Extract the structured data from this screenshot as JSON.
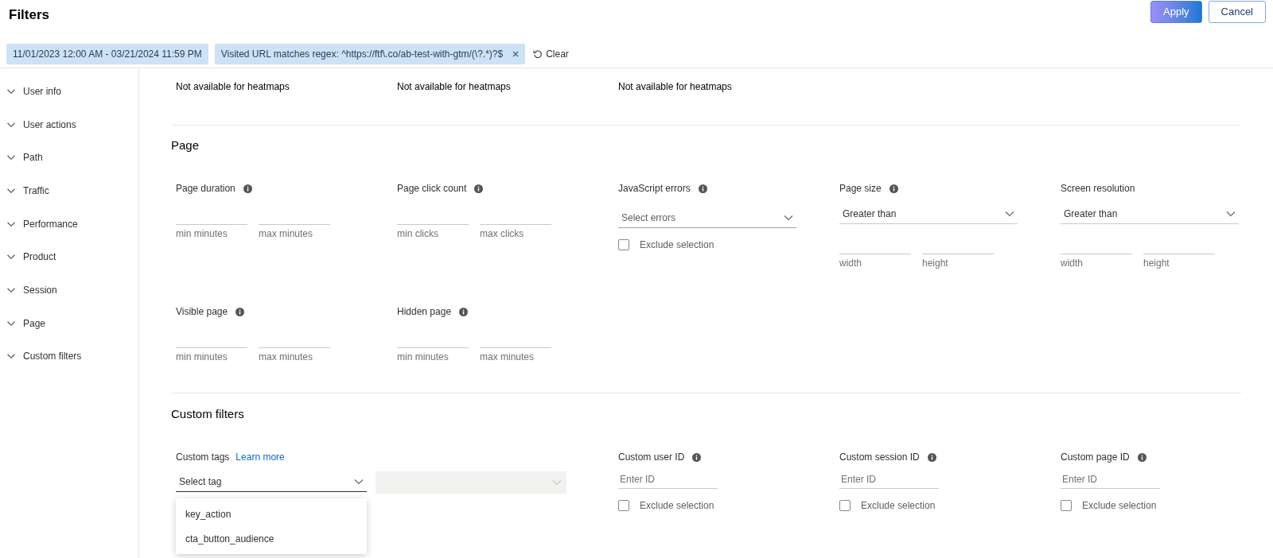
{
  "title": "Filters",
  "buttons": [
    {
      "label": "Apply",
      "kind": "primary"
    },
    {
      "label": "Cancel",
      "kind": "secondary"
    }
  ],
  "chips": [
    {
      "label": "11/01/2023 12:00 AM - 03/21/2024 11:59 PM",
      "removable": false
    },
    {
      "label": "Visited URL matches regex: ^https://ftf\\.co/ab-test-with-gtm/(\\?.*)?$",
      "removable": true
    }
  ],
  "clear_button": {
    "label": "Clear"
  },
  "sidebar": {
    "items": [
      {
        "label": "User info"
      },
      {
        "label": "User actions"
      },
      {
        "label": "Path"
      },
      {
        "label": "Traffic"
      },
      {
        "label": "Performance"
      },
      {
        "label": "Product"
      },
      {
        "label": "Session"
      },
      {
        "label": "Page"
      },
      {
        "label": "Custom filters"
      }
    ]
  },
  "session_section": {
    "values": [
      "Not available for heatmaps",
      "Not available for heatmaps",
      "Not available for heatmaps"
    ]
  },
  "page_section": {
    "title": "Page",
    "fields": [
      {
        "kind": "range",
        "label": "Page duration",
        "info": true,
        "min_label": "min minutes",
        "max_label": "max minutes"
      },
      {
        "kind": "range",
        "label": "Page click count",
        "info": true,
        "min_label": "min clicks",
        "max_label": "max clicks"
      },
      {
        "kind": "select",
        "label": "JavaScript errors",
        "info": true,
        "placeholder": "Select errors",
        "exclude_label": "Exclude selection",
        "exclude_checked": false
      },
      {
        "kind": "size",
        "label": "Page size",
        "info": true,
        "value": "Greater than",
        "width_label": "width",
        "height_label": "height"
      },
      {
        "kind": "size",
        "label": "Screen resolution",
        "info": false,
        "value": "Greater than",
        "width_label": "width",
        "height_label": "height"
      },
      {
        "kind": "range",
        "label": "Visible page",
        "info": true,
        "min_label": "min minutes",
        "max_label": "max minutes"
      },
      {
        "kind": "range",
        "label": "Hidden page",
        "info": true,
        "min_label": "min minutes",
        "max_label": "max minutes"
      }
    ]
  },
  "custom_section": {
    "title": "Custom filters",
    "fields": [
      {
        "kind": "tags",
        "label": "Custom tags",
        "link": "Learn more",
        "placeholder": "Select tag",
        "options": [
          "key_action",
          "cta_button_audience"
        ]
      },
      {
        "kind": "id",
        "label": "Custom user ID",
        "info": true,
        "placeholder": "Enter ID",
        "exclude_label": "Exclude selection",
        "exclude_checked": false
      },
      {
        "kind": "id",
        "label": "Custom session ID",
        "info": true,
        "placeholder": "Enter ID",
        "exclude_label": "Exclude selection",
        "exclude_checked": false
      },
      {
        "kind": "id",
        "label": "Custom page ID",
        "info": true,
        "placeholder": "Enter ID",
        "exclude_label": "Exclude selection",
        "exclude_checked": false
      }
    ]
  }
}
